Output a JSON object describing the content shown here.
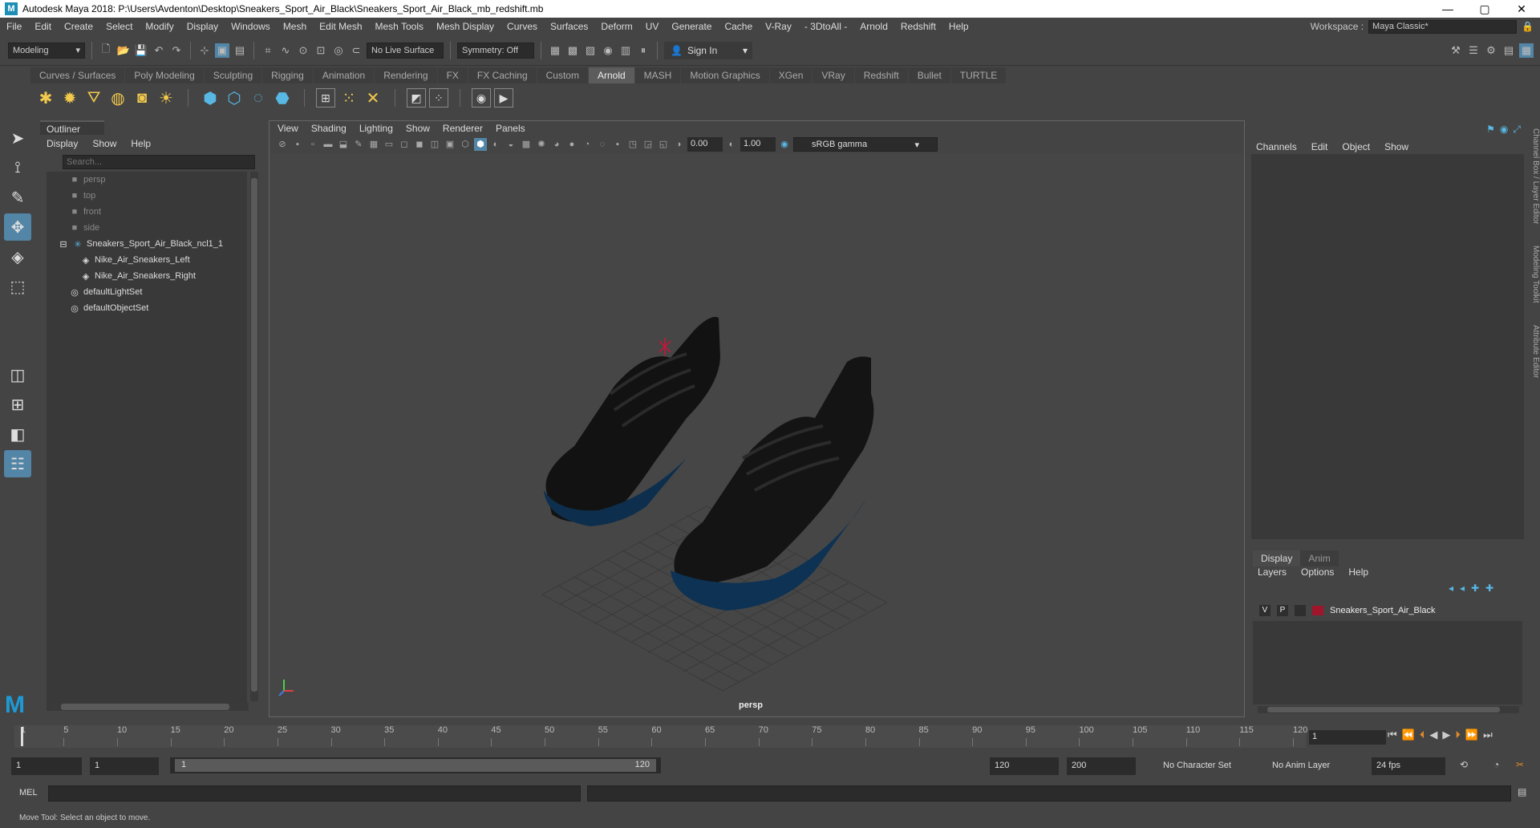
{
  "window": {
    "title": "Autodesk Maya 2018: P:\\Users\\Avdenton\\Desktop\\Sneakers_Sport_Air_Black\\Sneakers_Sport_Air_Black_mb_redshift.mb",
    "minimize": "—",
    "maximize": "▢",
    "close": "✕"
  },
  "menubar": {
    "items": [
      "File",
      "Edit",
      "Create",
      "Select",
      "Modify",
      "Display",
      "Windows",
      "Mesh",
      "Edit Mesh",
      "Mesh Tools",
      "Mesh Display",
      "Curves",
      "Surfaces",
      "Deform",
      "UV",
      "Generate",
      "Cache",
      "V-Ray",
      "- 3DtoAll -",
      "Arnold",
      "Redshift",
      "Help"
    ],
    "workspace_label": "Workspace :",
    "workspace_value": "Maya Classic*"
  },
  "statusline": {
    "mode": "Modeling",
    "live_surface": "No Live Surface",
    "symmetry": "Symmetry: Off",
    "sign_in": "Sign In"
  },
  "shelf": {
    "tabs": [
      "Curves / Surfaces",
      "Poly Modeling",
      "Sculpting",
      "Rigging",
      "Animation",
      "Rendering",
      "FX",
      "FX Caching",
      "Custom",
      "Arnold",
      "MASH",
      "Motion Graphics",
      "XGen",
      "VRay",
      "Redshift",
      "Bullet",
      "TURTLE"
    ],
    "active": "Arnold"
  },
  "outliner": {
    "title": "Outliner",
    "menu": [
      "Display",
      "Show",
      "Help"
    ],
    "search_placeholder": "Search...",
    "items": [
      {
        "label": "persp",
        "type": "camera"
      },
      {
        "label": "top",
        "type": "camera"
      },
      {
        "label": "front",
        "type": "camera"
      },
      {
        "label": "side",
        "type": "camera"
      },
      {
        "label": "Sneakers_Sport_Air_Black_ncl1_1",
        "type": "group"
      },
      {
        "label": "Nike_Air_Sneakers_Left",
        "type": "mesh"
      },
      {
        "label": "Nike_Air_Sneakers_Right",
        "type": "mesh"
      },
      {
        "label": "defaultLightSet",
        "type": "set"
      },
      {
        "label": "defaultObjectSet",
        "type": "set"
      }
    ]
  },
  "viewport": {
    "menu": [
      "View",
      "Shading",
      "Lighting",
      "Show",
      "Renderer",
      "Panels"
    ],
    "exposure": "0.00",
    "gamma_value": "1.00",
    "color_space": "sRGB gamma",
    "camera_label": "persp"
  },
  "channelbox": {
    "menu": [
      "Channels",
      "Edit",
      "Object",
      "Show"
    ],
    "side_tabs": [
      "Channel Box / Layer Editor",
      "Modeling Toolkit",
      "Attribute Editor"
    ]
  },
  "layer_editor": {
    "tabs": [
      "Display",
      "Anim"
    ],
    "menu": [
      "Layers",
      "Options",
      "Help"
    ],
    "layer": {
      "v": "V",
      "p": "P",
      "name": "Sneakers_Sport_Air_Black",
      "color": "#a0152a"
    }
  },
  "timeline": {
    "ticks": [
      "1",
      "5",
      "10",
      "15",
      "20",
      "25",
      "30",
      "35",
      "40",
      "45",
      "50",
      "55",
      "60",
      "65",
      "70",
      "75",
      "80",
      "85",
      "90",
      "95",
      "100",
      "105",
      "110",
      "115",
      "120"
    ],
    "current_frame": "1"
  },
  "range": {
    "start_a": "1",
    "start_b": "1",
    "slider_start": "1",
    "slider_end": "120",
    "end_a": "120",
    "end_b": "200",
    "character_set": "No Character Set",
    "anim_layer": "No Anim Layer",
    "fps": "24 fps"
  },
  "cmdline": {
    "label": "MEL"
  },
  "helpline": {
    "text": "Move Tool: Select an object to move."
  }
}
